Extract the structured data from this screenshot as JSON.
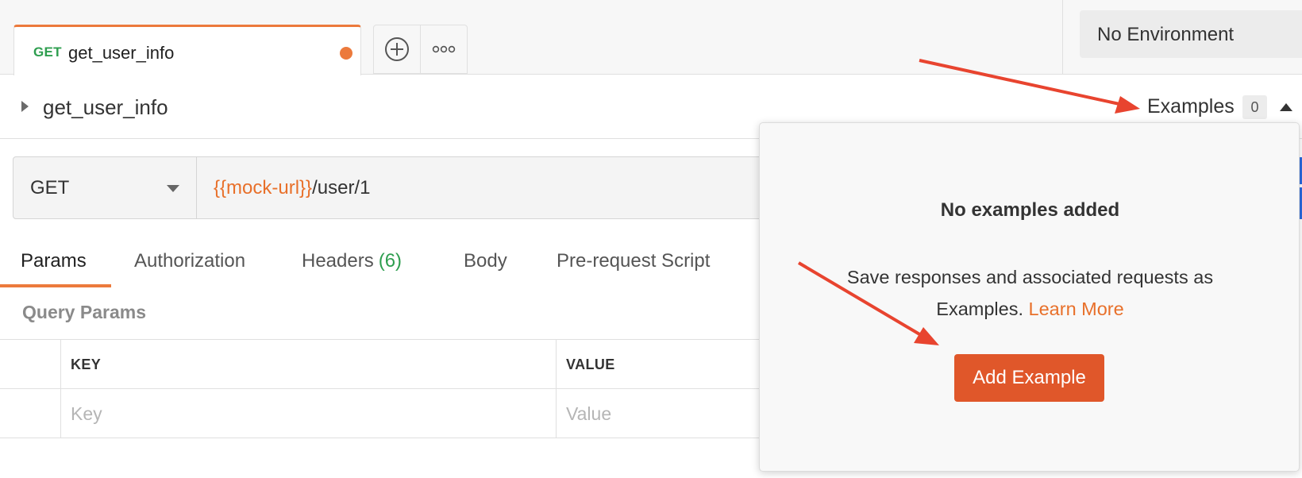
{
  "tab": {
    "method": "GET",
    "name": "get_user_info",
    "unsaved_dot_color": "#ec7a3c",
    "new_tab_icon": "plus-circle-icon",
    "more_icon": "more-icon"
  },
  "environment": {
    "selected": "No Environment"
  },
  "request": {
    "title": "get_user_info",
    "method": "GET",
    "url_variable": "{{mock-url}}",
    "url_path": "/user/1"
  },
  "examples": {
    "label": "Examples",
    "count": "0"
  },
  "request_tabs": [
    {
      "label": "Params",
      "active": true
    },
    {
      "label": "Authorization"
    },
    {
      "label": "Headers",
      "count": "(6)"
    },
    {
      "label": "Body"
    },
    {
      "label": "Pre-request Script"
    }
  ],
  "params": {
    "section_label": "Query Params",
    "columns": [
      "KEY",
      "VALUE"
    ],
    "placeholders": [
      "Key",
      "Value"
    ]
  },
  "examples_popover": {
    "title": "No examples added",
    "description_line1": "Save responses and associated requests as",
    "description_line2": "Examples.",
    "learn_more": "Learn More",
    "button": "Add Example"
  },
  "colors": {
    "accent": "#ec7a3c",
    "button": "#e0572a",
    "get_method": "#2e9e4f",
    "annotation_arrow": "#e8442f"
  }
}
